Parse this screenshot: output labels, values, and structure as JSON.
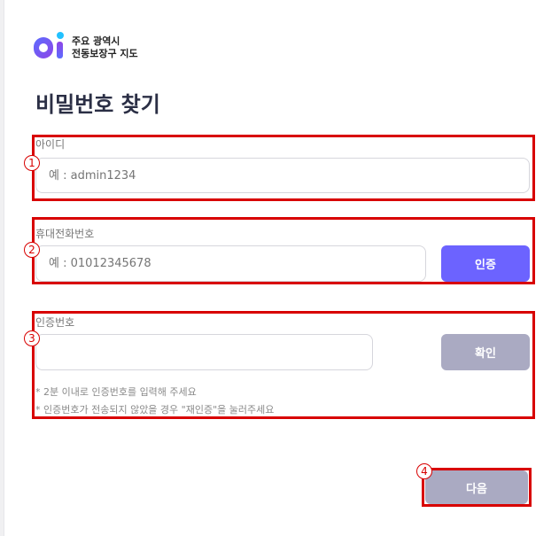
{
  "logo": {
    "line1": "주요 광역시",
    "line2": "전동보장구 지도"
  },
  "page_title": "비밀번호 찾기",
  "id_field": {
    "label": "아이디",
    "placeholder": "예 : admin1234"
  },
  "phone_field": {
    "label": "휴대전화번호",
    "placeholder": "예 : 01012345678",
    "button": "인증"
  },
  "code_field": {
    "label": "인증번호",
    "placeholder": "",
    "button": "확인",
    "notes": [
      "* 2분 이내로 인증번호를 입력해 주세요",
      "* 인증번호가 전송되지 않았을 경우 \"재인증\"을 눌러주세요"
    ]
  },
  "next_button": "다음",
  "annotations": [
    "1",
    "2",
    "3",
    "4"
  ],
  "colors": {
    "primary": "#6c63ff",
    "disabled": "#aaaac2",
    "highlight": "#d80000",
    "title": "#2b2f45"
  }
}
